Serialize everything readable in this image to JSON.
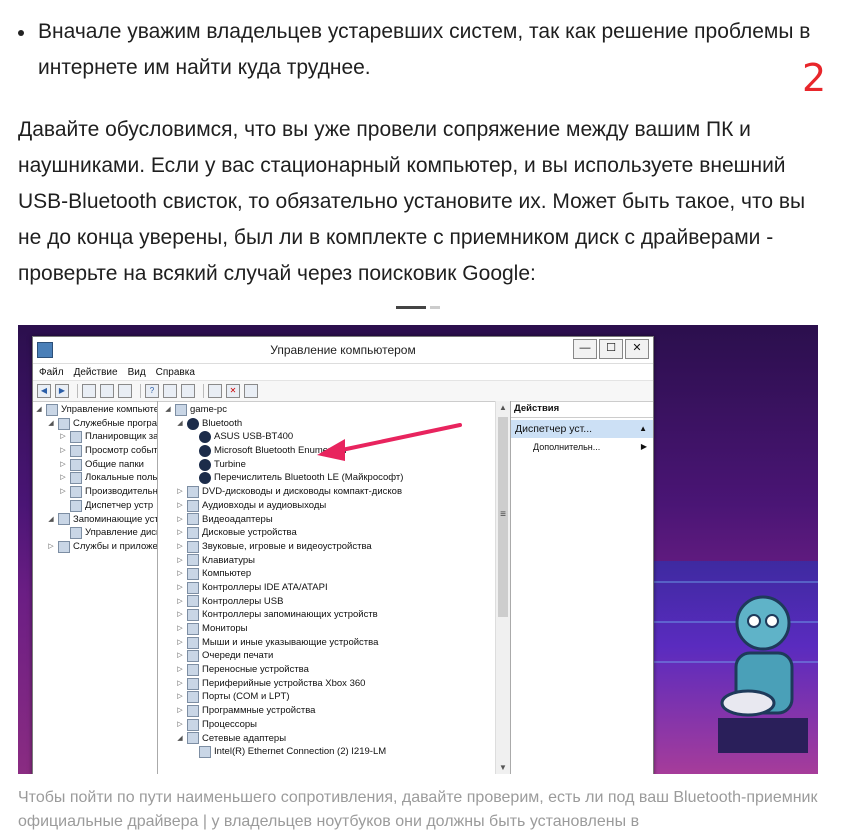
{
  "bullet": "Вначале уважим владельцев устаревших систем, так как решение проблемы в интернете им найти куда труднее.",
  "step_number": "2",
  "paragraph": "Давайте обусловимся, что вы уже провели сопряжение между вашим ПК и наушниками. Если у вас стационарный компьютер, и вы используете внешний USB-Bluetooth свисток, то обязательно установите их. Может быть такое, что вы не до конца уверены, был ли в комплекте с приемником диск с драйверами - проверьте на всякий случай через поисковик Google:",
  "window": {
    "title": "Управление компьютером",
    "buttons": {
      "minimize": "—",
      "maximize": "☐",
      "close": "✕"
    },
    "menu": [
      "Файл",
      "Действие",
      "Вид",
      "Справка"
    ]
  },
  "left_tree": [
    {
      "label": "Управление компьютер",
      "level": 0,
      "tri": "◢"
    },
    {
      "label": "Служебные програм",
      "level": 1,
      "tri": "◢"
    },
    {
      "label": "Планировщик зад",
      "level": 2,
      "tri": "▷"
    },
    {
      "label": "Просмотр событи",
      "level": 2,
      "tri": "▷"
    },
    {
      "label": "Общие папки",
      "level": 2,
      "tri": "▷"
    },
    {
      "label": "Локальные польз",
      "level": 2,
      "tri": "▷"
    },
    {
      "label": "Производительн",
      "level": 2,
      "tri": "▷"
    },
    {
      "label": "Диспетчер устр",
      "level": 2,
      "tri": ""
    },
    {
      "label": "Запоминающие устр",
      "level": 1,
      "tri": "◢"
    },
    {
      "label": "Управление диска",
      "level": 2,
      "tri": ""
    },
    {
      "label": "Службы и приложен",
      "level": 1,
      "tri": "▷"
    }
  ],
  "device_tree": [
    {
      "label": "game-pc",
      "level": 0,
      "tri": "◢",
      "bt": false
    },
    {
      "label": "Bluetooth",
      "level": 1,
      "tri": "◢",
      "bt": true
    },
    {
      "label": "ASUS USB-BT400",
      "level": 2,
      "tri": "",
      "bt": true
    },
    {
      "label": "Microsoft Bluetooth Enumerator",
      "level": 2,
      "tri": "",
      "bt": true
    },
    {
      "label": "Turbine",
      "level": 2,
      "tri": "",
      "bt": true
    },
    {
      "label": "Перечислитель Bluetooth LE (Майкрософт)",
      "level": 2,
      "tri": "",
      "bt": true
    },
    {
      "label": "DVD-дисководы и дисководы компакт-дисков",
      "level": 1,
      "tri": "▷",
      "bt": false
    },
    {
      "label": "Аудиовходы и аудиовыходы",
      "level": 1,
      "tri": "▷",
      "bt": false
    },
    {
      "label": "Видеоадаптеры",
      "level": 1,
      "tri": "▷",
      "bt": false
    },
    {
      "label": "Дисковые устройства",
      "level": 1,
      "tri": "▷",
      "bt": false
    },
    {
      "label": "Звуковые, игровые и видеоустройства",
      "level": 1,
      "tri": "▷",
      "bt": false
    },
    {
      "label": "Клавиатуры",
      "level": 1,
      "tri": "▷",
      "bt": false
    },
    {
      "label": "Компьютер",
      "level": 1,
      "tri": "▷",
      "bt": false
    },
    {
      "label": "Контроллеры IDE ATA/ATAPI",
      "level": 1,
      "tri": "▷",
      "bt": false
    },
    {
      "label": "Контроллеры USB",
      "level": 1,
      "tri": "▷",
      "bt": false
    },
    {
      "label": "Контроллеры запоминающих устройств",
      "level": 1,
      "tri": "▷",
      "bt": false
    },
    {
      "label": "Мониторы",
      "level": 1,
      "tri": "▷",
      "bt": false
    },
    {
      "label": "Мыши и иные указывающие устройства",
      "level": 1,
      "tri": "▷",
      "bt": false
    },
    {
      "label": "Очереди печати",
      "level": 1,
      "tri": "▷",
      "bt": false
    },
    {
      "label": "Переносные устройства",
      "level": 1,
      "tri": "▷",
      "bt": false
    },
    {
      "label": "Периферийные устройства Xbox 360",
      "level": 1,
      "tri": "▷",
      "bt": false
    },
    {
      "label": "Порты (COM и LPT)",
      "level": 1,
      "tri": "▷",
      "bt": false
    },
    {
      "label": "Программные устройства",
      "level": 1,
      "tri": "▷",
      "bt": false
    },
    {
      "label": "Процессоры",
      "level": 1,
      "tri": "▷",
      "bt": false
    },
    {
      "label": "Сетевые адаптеры",
      "level": 1,
      "tri": "◢",
      "bt": false
    },
    {
      "label": "Intel(R) Ethernet Connection (2) I219-LM",
      "level": 2,
      "tri": "",
      "bt": false
    }
  ],
  "actions": {
    "header": "Действия",
    "selected": "Диспетчер уст...",
    "more": "Дополнительн..."
  },
  "caption": "Чтобы пойти по пути наименьшего сопротивления, давайте проверим, есть ли под ваш Bluetooth-приемник официальные драйвера | у владельцев ноутбуков они должны быть установлены в",
  "colors": {
    "accent_red": "#e8262b",
    "arrow": "#e8245e",
    "selection": "#cce0f5"
  }
}
